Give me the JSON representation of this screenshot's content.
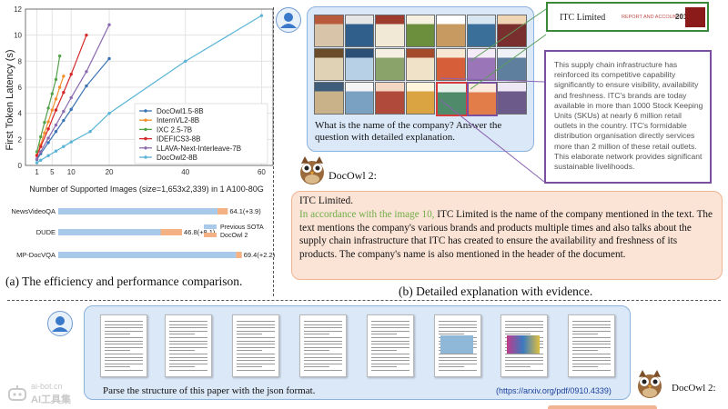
{
  "chart_data": [
    {
      "type": "line",
      "xlabel": "Number of Supported Images (size=1,653x2,339) in 1 A100-80G",
      "ylabel": "First Token Latency (s)",
      "xticks": [
        1,
        5,
        10,
        20,
        40,
        60
      ],
      "yticks": [
        0,
        2,
        4,
        6,
        8,
        10,
        12
      ],
      "xlim": [
        -2,
        63
      ],
      "ylim": [
        0,
        12
      ],
      "grid": true,
      "legend_position": "right",
      "series": [
        {
          "name": "DocOwl1.5-8B",
          "color": "#3b74b4",
          "x": [
            1,
            2,
            4,
            6,
            8,
            10,
            14,
            20
          ],
          "y": [
            0.45,
            0.9,
            1.75,
            2.6,
            3.45,
            4.3,
            6.1,
            8.2
          ]
        },
        {
          "name": "InternVL2-8B",
          "color": "#f28e2b",
          "x": [
            1,
            2,
            3,
            4,
            5,
            6,
            7,
            8
          ],
          "y": [
            0.8,
            1.6,
            2.5,
            3.35,
            4.25,
            5.1,
            6.0,
            6.85
          ]
        },
        {
          "name": "IXC 2.5-7B",
          "color": "#54a24b",
          "x": [
            1,
            2,
            3,
            4,
            5,
            6,
            7
          ],
          "y": [
            1.05,
            2.2,
            3.3,
            4.4,
            5.5,
            6.6,
            8.4
          ]
        },
        {
          "name": "IDEFICS3-8B",
          "color": "#d62728",
          "x": [
            1,
            2,
            4,
            6,
            8,
            10,
            14
          ],
          "y": [
            0.75,
            1.45,
            2.8,
            4.25,
            5.6,
            7.0,
            10.0
          ]
        },
        {
          "name": "LLAVA-Next-Interleave-7B",
          "color": "#8c6bb1",
          "x": [
            1,
            2,
            4,
            6,
            8,
            10,
            14,
            20
          ],
          "y": [
            0.5,
            1.05,
            2.1,
            3.1,
            4.15,
            5.2,
            7.2,
            10.8
          ]
        },
        {
          "name": "DocOwl2-8B",
          "color": "#5ab4d6",
          "x": [
            1,
            2,
            4,
            6,
            8,
            10,
            15,
            20,
            40,
            60
          ],
          "y": [
            0.2,
            0.4,
            0.75,
            1.1,
            1.45,
            1.8,
            2.6,
            4.0,
            8.0,
            11.5
          ]
        }
      ]
    },
    {
      "type": "bar",
      "categories": [
        "NewsVideoQA",
        "DUDE",
        "MP-DocVQA"
      ],
      "series": [
        {
          "name": "Previous SOTA",
          "color": "#a9c9ea",
          "values": [
            60.2,
            38.7,
            67.2
          ]
        },
        {
          "name": "DocOwl 2",
          "color": "#f4b183",
          "values": [
            64.1,
            46.8,
            69.4
          ]
        }
      ],
      "value_labels": [
        "64.1(+3.9)",
        "46.8(+8.1)",
        "69.4(+2.2)"
      ],
      "xlim": [
        0,
        75
      ],
      "legend_position": "right"
    }
  ],
  "captions": {
    "a": "(a) The efficiency and performance comparison.",
    "b": "(b) Detailed explanation with evidence."
  },
  "top_chat": {
    "question": "What is the name of the company? Answer the question with detailed explanation.",
    "header_company": "ITC Limited",
    "header_report": "REPORT AND ACCOUNTS",
    "header_year": "2013",
    "evidence_text": "This supply chain infrastructure has reinforced its competitive capability significantly to ensure visibility, availability and freshness. ITC's brands are today available in more than 1000 Stock Keeping Units (SKUs) at nearly 6 million retail outlets in the country. ITC's formidable distribution organisation directly services more than 2 million of these retail outlets. This elaborate network provides significant sustainable livelihoods.",
    "bot_name": "DocOwl 2:",
    "answer_title": "ITC Limited.",
    "answer_highlight": "In accordance with the image 10,",
    "answer_body": " ITC Limited is the name of the company mentioned in the text. The text mentions the company's various brands and products multiple times and also talks about the supply chain infrastructure that ITC has created to ensure the availability and freshness of its products. The company's name is also mentioned in the header of the document."
  },
  "bottom_chat": {
    "question": "Parse the structure of this paper with the json format.",
    "link": "(https://arxiv.org/pdf/0910.4339)",
    "bot_name": "DocOwl 2:"
  },
  "watermark": {
    "line1": "ai-bot.cn",
    "line2": "AI工具集"
  },
  "colors": {
    "user_bubble": "#dbe8f8",
    "answer_bubble": "#fbe4d6",
    "highlight_text": "#70ad47",
    "evidence_border": "#7b4fa0",
    "header_border": "#3a8a3a"
  }
}
